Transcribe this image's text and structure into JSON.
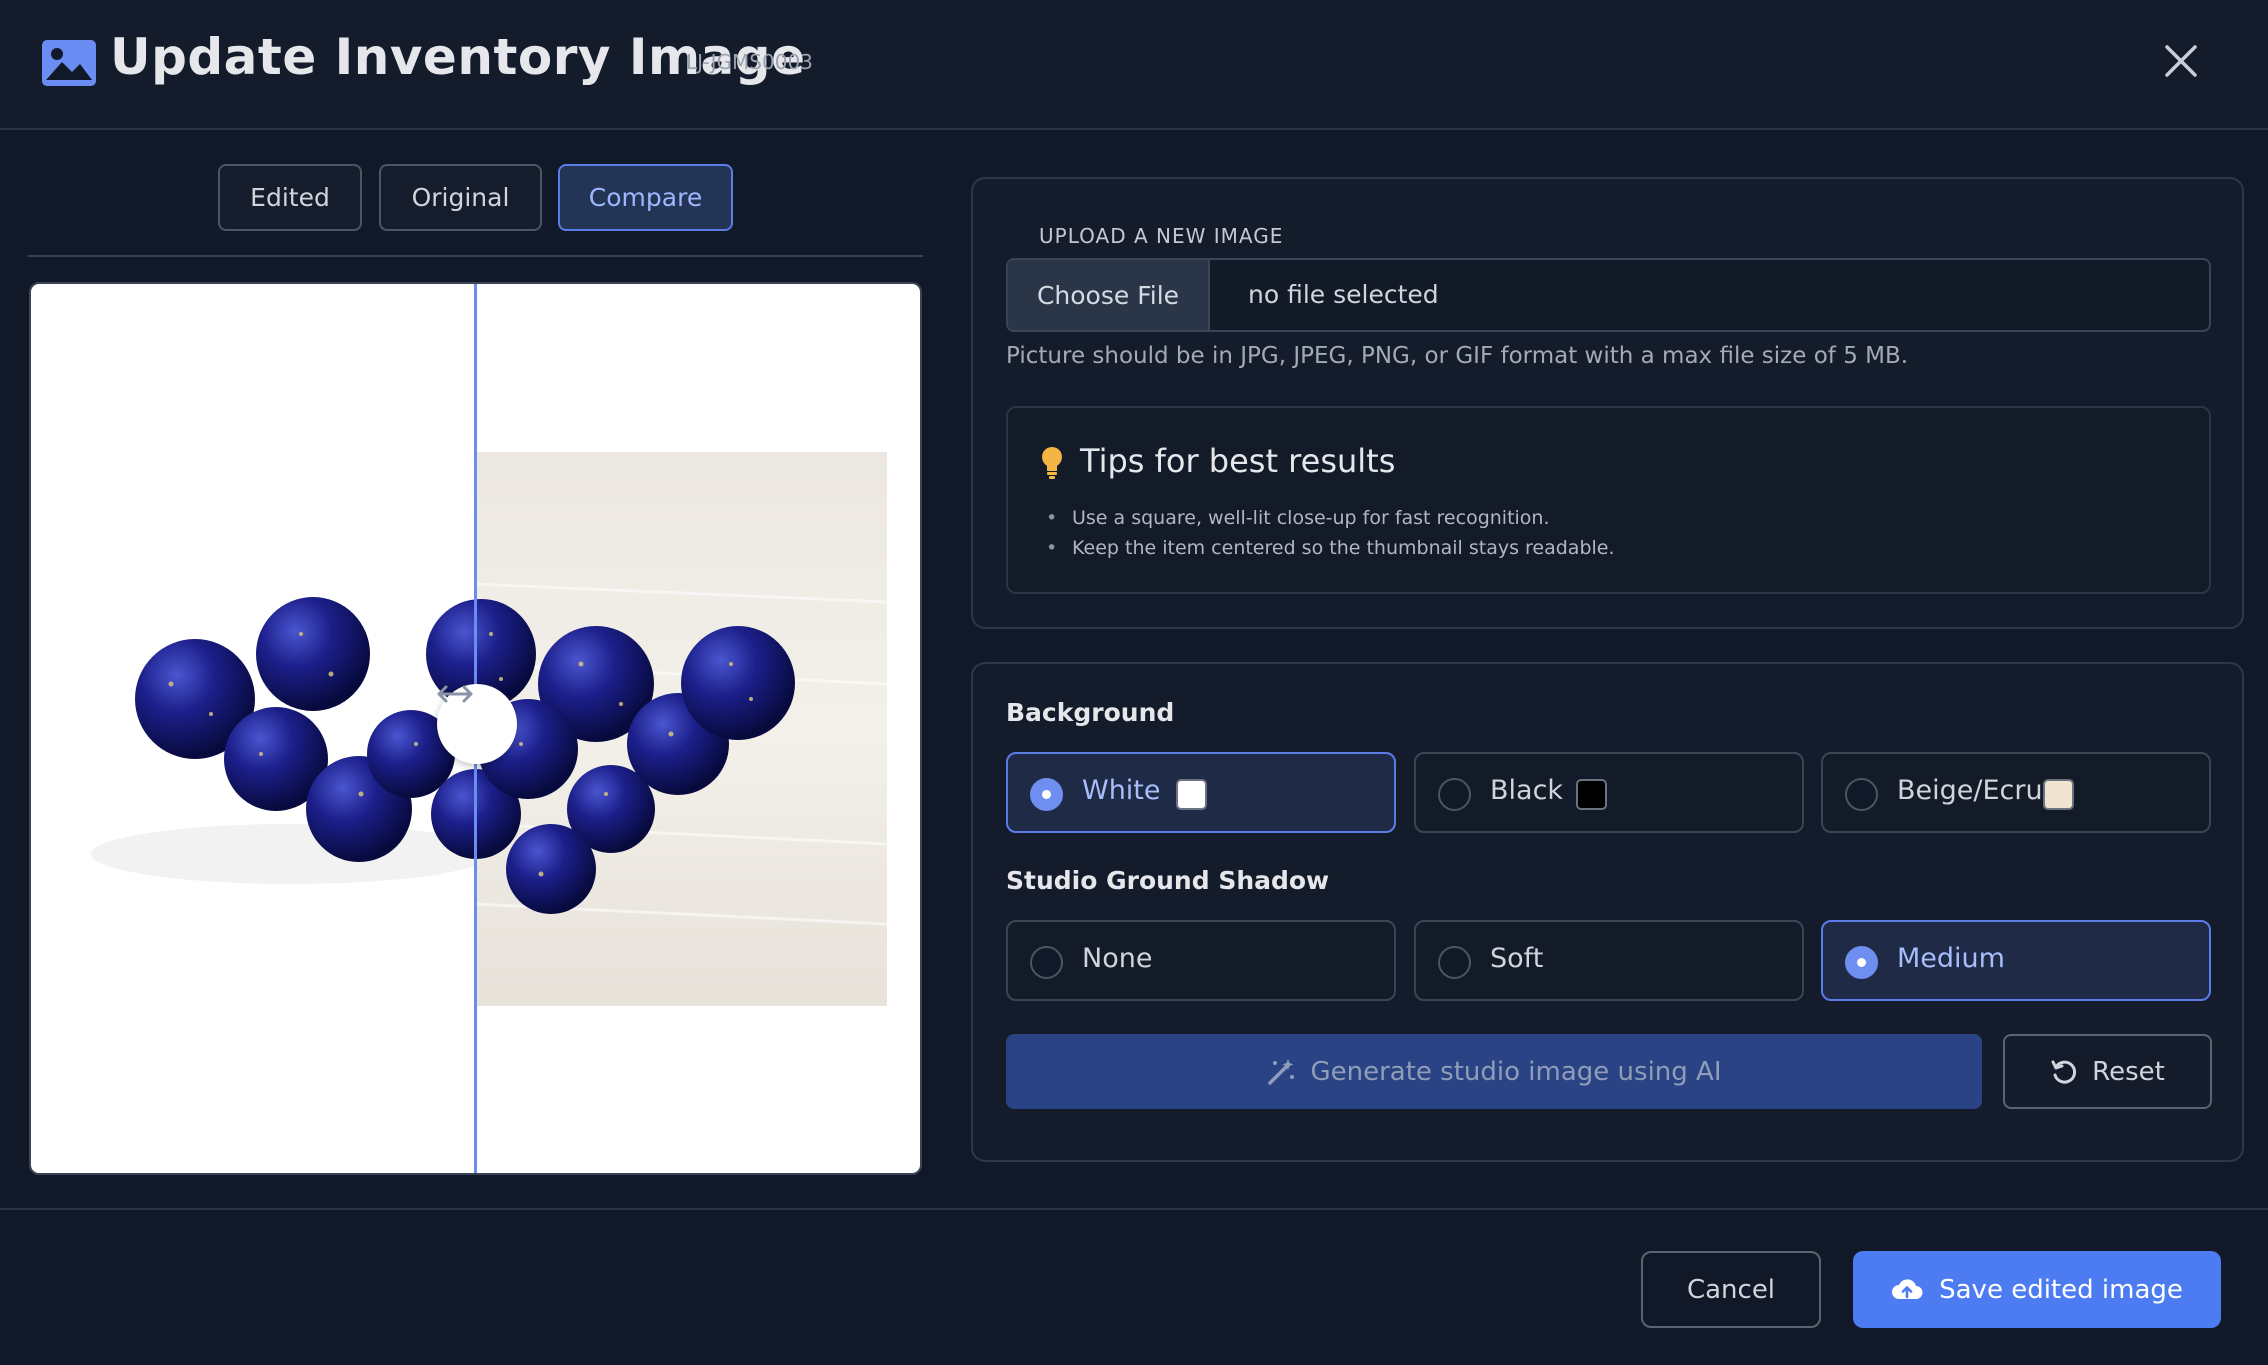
{
  "header": {
    "title": "Update Inventory Image",
    "sku": "LJ-JGMS0003",
    "title_icon": "image-icon",
    "close_icon": "close-icon"
  },
  "view_tabs": [
    {
      "label": "Edited",
      "active": false
    },
    {
      "label": "Original",
      "active": false
    },
    {
      "label": "Compare",
      "active": true
    }
  ],
  "preview": {
    "mode": "compare",
    "handle_icon": "arrows-horizontal-icon",
    "split_fraction": 0.5
  },
  "upload": {
    "section_label": "UPLOAD A NEW IMAGE",
    "button_label": "Choose File",
    "file_status": "no file selected",
    "hint": "Picture should be in JPG, JPEG, PNG, or GIF format with a max file size of 5 MB."
  },
  "tips": {
    "icon": "lightbulb-icon",
    "title": "Tips for best results",
    "items": [
      "Use a square, well-lit close-up for fast recognition.",
      "Keep the item centered so the thumbnail stays readable."
    ]
  },
  "background": {
    "label": "Background",
    "options": [
      {
        "label": "White",
        "swatch": "#ffffff",
        "selected": true
      },
      {
        "label": "Black",
        "swatch": "#000000",
        "selected": false
      },
      {
        "label": "Beige/Ecru",
        "swatch": "#efe4cf",
        "selected": false
      }
    ]
  },
  "shadow": {
    "label": "Studio Ground Shadow",
    "options": [
      {
        "label": "None",
        "selected": false
      },
      {
        "label": "Soft",
        "selected": false
      },
      {
        "label": "Medium",
        "selected": true
      }
    ]
  },
  "actions": {
    "generate_label": "Generate studio image using AI",
    "generate_icon": "magic-wand-icon",
    "reset_label": "Reset",
    "reset_icon": "reset-icon"
  },
  "footer": {
    "cancel_label": "Cancel",
    "save_label": "Save edited image",
    "save_icon": "cloud-upload-icon"
  },
  "colors": {
    "background": "#111827",
    "accent": "#4d7cf2",
    "selected_border": "#5b7ce6",
    "bead_blue": "#1c1f8a"
  }
}
